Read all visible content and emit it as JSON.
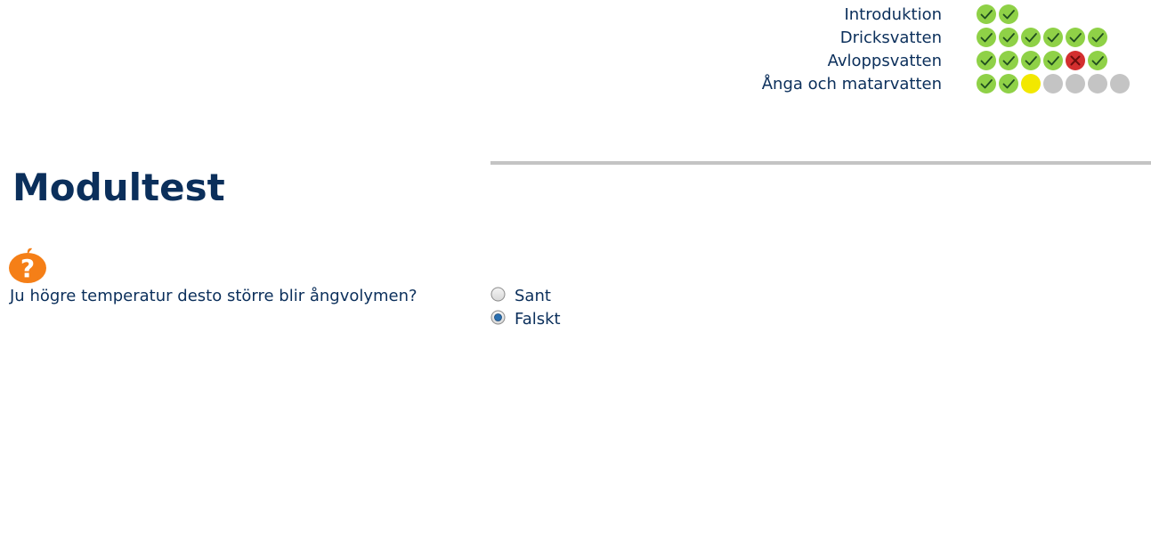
{
  "progress": {
    "rows": [
      {
        "label": "Introduktion",
        "dots": [
          "done",
          "done"
        ]
      },
      {
        "label": "Dricksvatten",
        "dots": [
          "done",
          "done",
          "done",
          "done",
          "done",
          "done"
        ]
      },
      {
        "label": "Avloppsvatten",
        "dots": [
          "done",
          "done",
          "done",
          "done",
          "failed",
          "done"
        ]
      },
      {
        "label": "Ånga och matarvatten",
        "dots": [
          "done",
          "done",
          "current",
          "pending",
          "pending",
          "pending",
          "pending"
        ]
      }
    ]
  },
  "colors": {
    "text": "#0b2f5b",
    "done": "#8fd147",
    "failed": "#d32f2f",
    "current": "#f2e800",
    "pending": "#c4c4c4",
    "icon_orange": "#f57f17"
  },
  "page_title": "Modultest",
  "question": {
    "icon": "question-mark-icon",
    "text": "Ju högre temperatur desto större blir ångvolymen?",
    "options": [
      {
        "label": "Sant",
        "selected": false
      },
      {
        "label": "Falskt",
        "selected": true
      }
    ]
  }
}
